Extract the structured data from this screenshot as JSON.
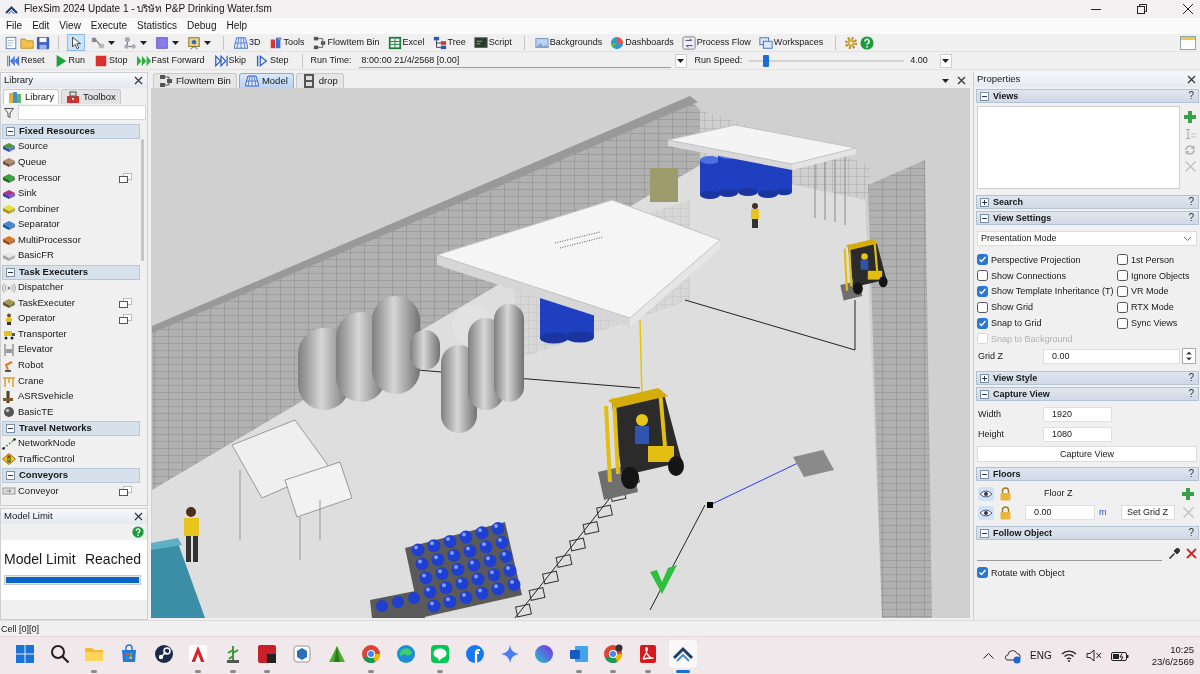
{
  "window": {
    "title": "FlexSim 2024 Update 1 - บริษัท P&P Drinking Water.fsm"
  },
  "menu": [
    "File",
    "Edit",
    "View",
    "Execute",
    "Statistics",
    "Debug",
    "Help"
  ],
  "toolbar": {
    "edit_tools": [
      {
        "selected": true
      },
      {
        "selected": false
      },
      {
        "selected": false
      },
      {
        "selected": false
      },
      {
        "selected": false
      }
    ],
    "buttons": [
      "3D",
      "Tools",
      "FlowItem Bin",
      "Excel",
      "Tree",
      "Script",
      "Backgrounds",
      "Dashboards",
      "Process Flow",
      "Workspaces"
    ]
  },
  "run_controls": {
    "buttons": [
      "Reset",
      "Run",
      "Stop",
      "Fast Forward",
      "Skip",
      "Step"
    ],
    "run_time": {
      "label": "Run Time:",
      "value": "8:00:00 21/4/2568 [0.00]"
    },
    "run_speed": {
      "label": "Run Speed:",
      "level": 0.09,
      "reading": "4.00"
    }
  },
  "library": {
    "title": "Library",
    "tabs": [
      {
        "label": "Library",
        "selected": true
      },
      {
        "label": "Toolbox",
        "selected": false
      }
    ],
    "categories": [
      {
        "label": "Fixed Resources",
        "expanded": true,
        "items": [
          {
            "label": "Source",
            "variants": false
          },
          {
            "label": "Queue",
            "variants": false
          },
          {
            "label": "Processor",
            "variants": true
          },
          {
            "label": "Sink",
            "variants": false
          },
          {
            "label": "Combiner",
            "variants": false
          },
          {
            "label": "Separator",
            "variants": false
          },
          {
            "label": "MultiProcessor",
            "variants": false
          },
          {
            "label": "BasicFR",
            "variants": false
          }
        ]
      },
      {
        "label": "Task Executers",
        "expanded": true,
        "items": [
          {
            "label": "Dispatcher",
            "variants": false
          },
          {
            "label": "TaskExecuter",
            "variants": true
          },
          {
            "label": "Operator",
            "variants": true
          },
          {
            "label": "Transporter",
            "variants": false
          },
          {
            "label": "Elevator",
            "variants": false
          },
          {
            "label": "Robot",
            "variants": false
          },
          {
            "label": "Crane",
            "variants": false
          },
          {
            "label": "ASRSvehicle",
            "variants": false
          },
          {
            "label": "BasicTE",
            "variants": false
          }
        ]
      },
      {
        "label": "Travel Networks",
        "expanded": true,
        "items": [
          {
            "label": "NetworkNode",
            "variants": false
          },
          {
            "label": "TrafficControl",
            "variants": false
          }
        ]
      },
      {
        "label": "Conveyors",
        "expanded": true,
        "items": [
          {
            "label": "Conveyor",
            "variants": true
          }
        ]
      }
    ]
  },
  "model_limit": {
    "title": "Model Limit",
    "heading": "Model Limit",
    "status": "Reached",
    "level": 1
  },
  "document_tabs": [
    {
      "label": "FlowItem Bin",
      "selected": false
    },
    {
      "label": "Model",
      "selected": true
    },
    {
      "label": "drop",
      "selected": false
    }
  ],
  "properties": {
    "title": "Properties",
    "sections": [
      {
        "kind": "views",
        "title": "Views",
        "help": "?",
        "expanded": true
      },
      {
        "kind": "search",
        "title": "Search",
        "help": "?",
        "expanded": false
      },
      {
        "kind": "view_settings",
        "title": "View Settings",
        "help": "?",
        "expanded": true,
        "mode": "Presentation Mode",
        "options": [
          {
            "label": "Perspective Projection",
            "checked": true,
            "disabled": false
          },
          {
            "label": "1st Person",
            "checked": false,
            "disabled": false
          },
          {
            "label": "Show Connections",
            "checked": false,
            "disabled": false
          },
          {
            "label": "Ignore Objects",
            "checked": false,
            "disabled": false
          },
          {
            "label": "Show Template Inheritance (T)",
            "checked": true,
            "disabled": false
          },
          {
            "label": "VR Mode",
            "checked": false,
            "disabled": false
          },
          {
            "label": "Show Grid",
            "checked": false,
            "disabled": false
          },
          {
            "label": "RTX Mode",
            "checked": false,
            "disabled": false
          },
          {
            "label": "Snap to Grid",
            "checked": true,
            "disabled": false
          },
          {
            "label": "Sync Views",
            "checked": false,
            "disabled": false
          },
          {
            "label": "Snap to Background",
            "checked": false,
            "disabled": true
          }
        ],
        "grid_z": {
          "label": "Grid Z",
          "value": "0.00"
        }
      },
      {
        "kind": "view_style",
        "title": "View Style",
        "help": "?",
        "expanded": false
      },
      {
        "kind": "capture_view",
        "title": "Capture View",
        "help": "?",
        "expanded": true,
        "fields": [
          {
            "label": "Width",
            "value": "1920"
          },
          {
            "label": "Height",
            "value": "1080"
          }
        ],
        "button": "Capture View"
      },
      {
        "kind": "floors",
        "title": "Floors",
        "help": "?",
        "expanded": true,
        "column_label": "Floor Z",
        "value": "0.00",
        "unit": "m",
        "button": "Set Grid Z"
      },
      {
        "kind": "follow_object",
        "title": "Follow Object",
        "help": "?",
        "expanded": true,
        "option": {
          "label": "Rotate with Object",
          "checked": true
        }
      }
    ]
  },
  "status_bar": {
    "text": "Cell [0][0]"
  },
  "taskbar": {
    "apps": [
      {
        "running": true,
        "selected": false
      },
      {
        "running": false,
        "selected": false
      },
      {
        "running": false,
        "selected": false
      },
      {
        "running": true,
        "selected": false
      },
      {
        "running": true,
        "selected": false
      },
      {
        "running": true,
        "selected": false
      },
      {
        "running": false,
        "selected": false
      },
      {
        "running": false,
        "selected": false
      },
      {
        "running": true,
        "selected": false
      },
      {
        "running": false,
        "selected": false
      },
      {
        "running": true,
        "selected": false
      },
      {
        "running": false,
        "selected": false
      },
      {
        "running": false,
        "selected": false
      },
      {
        "running": false,
        "selected": false
      },
      {
        "running": true,
        "selected": false
      },
      {
        "running": true,
        "selected": false
      },
      {
        "running": true,
        "selected": false
      },
      {
        "running": true,
        "selected": true
      }
    ],
    "language": "ENG",
    "time": "10:25",
    "date": "23/6/2569"
  }
}
